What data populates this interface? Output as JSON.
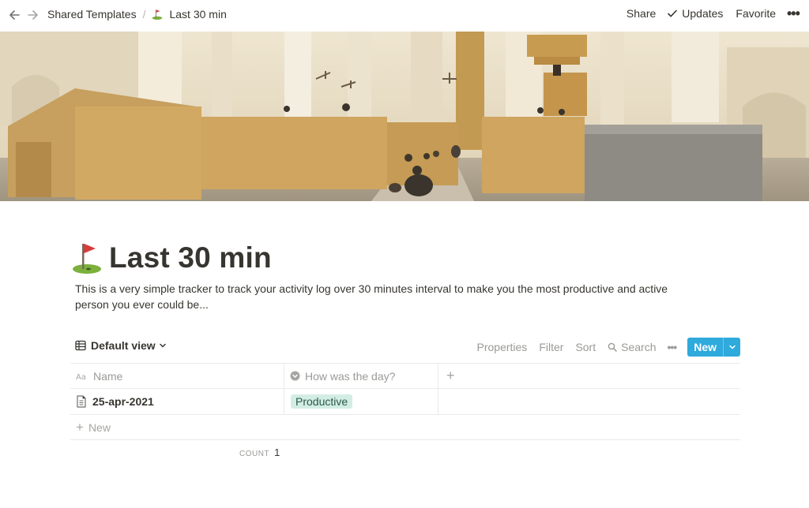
{
  "topbar": {
    "breadcrumbs": [
      "Shared Templates",
      "Last 30 min"
    ],
    "actions": {
      "share": "Share",
      "updates": "Updates",
      "favorite": "Favorite",
      "more": "•••"
    }
  },
  "page": {
    "title": "Last 30 min",
    "icon": "golf-flag-icon",
    "description": "This is a very simple tracker to track your activity log over 30 minutes interval to make you the most productive and active person you ever could be..."
  },
  "database": {
    "view_label": "Default view",
    "toolbar": {
      "properties": "Properties",
      "filter": "Filter",
      "sort": "Sort",
      "search": "Search",
      "more": "•••",
      "new": "New"
    },
    "columns": [
      {
        "label": "Name",
        "icon": "text-aa-icon"
      },
      {
        "label": "How was the day?",
        "icon": "select-icon"
      }
    ],
    "add_column": "+",
    "rows": [
      {
        "name": "25-apr-2021",
        "status": "Productive"
      }
    ],
    "new_row": "New",
    "count_label": "COUNT",
    "count_value": "1"
  },
  "colors": {
    "accent": "#2eaadc",
    "tag_bg": "#d3ede4",
    "text": "#37352f",
    "muted": "#9b9a97"
  }
}
